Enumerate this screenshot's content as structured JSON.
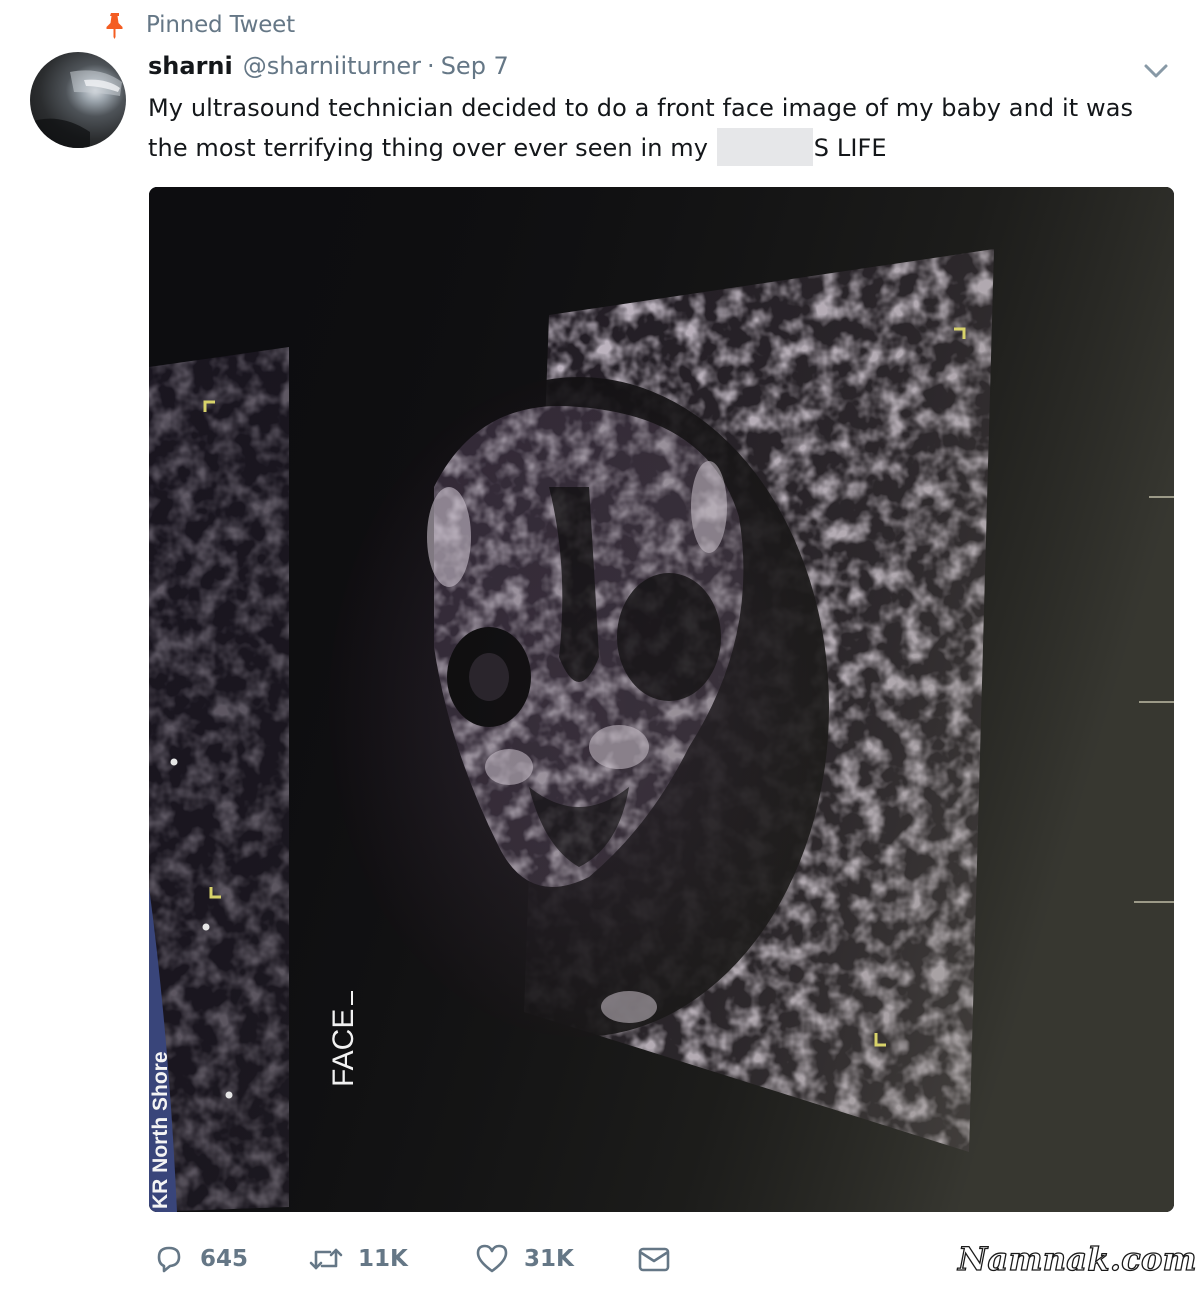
{
  "pinned": {
    "label": "Pinned Tweet",
    "icon": "pin-icon",
    "color": "#f45d22"
  },
  "tweet": {
    "display_name": "sharni",
    "handle": "@sharniiturner",
    "separator": "·",
    "date": "Sep 7",
    "text_before_redaction": "My ultrasound technician decided to do a front face image of my baby and it was the most terrifying thing over ever seen in my",
    "text_after_redaction": "S LIFE",
    "menu_icon": "chevron-down-icon"
  },
  "media": {
    "overlay_label": "FACE",
    "vertical_label": "KR North Shore",
    "description_icon": "ultrasound-image"
  },
  "actions": {
    "reply": {
      "icon": "reply-icon",
      "count": "645"
    },
    "retweet": {
      "icon": "retweet-icon",
      "count": "11K"
    },
    "like": {
      "icon": "heart-icon",
      "count": "31K"
    },
    "message": {
      "icon": "envelope-icon"
    }
  },
  "watermark": "Namnak.com",
  "colors": {
    "secondary_text": "#657786",
    "primary_text": "#14171a",
    "pin": "#f45d22"
  }
}
